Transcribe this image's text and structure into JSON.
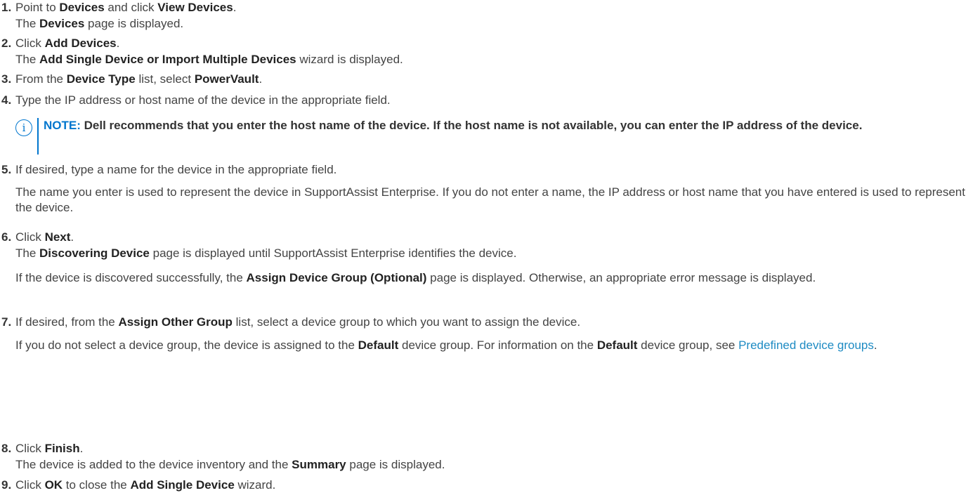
{
  "steps": [
    {
      "n": "1.",
      "a": "Point to ",
      "b1": "Devices",
      "c": " and click ",
      "b2": "View Devices",
      "d": ".",
      "sub_b": "Devices",
      "sub_rest": " page is displayed.",
      "sub_pre": "The "
    },
    {
      "n": "2.",
      "a": "Click ",
      "b1": "Add Devices",
      "d": ".",
      "sub_pre": "The ",
      "sub_b": "Add Single Device or Import Multiple Devices",
      "sub_rest": " wizard is displayed."
    },
    {
      "n": "3.",
      "a": "From the ",
      "b1": "Device Type",
      "c": " list, select ",
      "b2": "PowerVault",
      "d": "."
    },
    {
      "n": "4.",
      "a": "Type the IP address or host name of the device in the appropriate field."
    },
    {
      "n": "5.",
      "a": "If desired, type a name for the device in the appropriate field.",
      "para": "The name you enter is used to represent the device in SupportAssist Enterprise. If you do not enter a name, the IP address or host name that you have entered is used to represent the device."
    },
    {
      "n": "6.",
      "a": "Click ",
      "b1": "Next",
      "d": ".",
      "sub_pre": "The ",
      "sub_b": "Discovering Device",
      "sub_rest": " page is displayed until SupportAssist Enterprise identifies the device.",
      "para_pre": "If the device is discovered successfully, the ",
      "para_b": "Assign Device Group (Optional)",
      "para_rest": " page is displayed. Otherwise, an appropriate error message is displayed."
    },
    {
      "n": "7.",
      "a": "If desired, from the ",
      "b1": "Assign Other Group",
      "c": " list, select a device group to which you want to assign the device.",
      "para_pre": "If you do not select a device group, the device is assigned to the ",
      "para_b": "Default",
      "para_mid": " device group. For information on the ",
      "para_b2": "Default",
      "para_mid2": " device group, see ",
      "para_link": "Predefined device groups",
      "para_end": "."
    },
    {
      "n": "8.",
      "a": "Click ",
      "b1": "Finish",
      "d": ".",
      "sub_pre": "The device is added to the device inventory and the ",
      "sub_b": "Summary",
      "sub_rest": " page is displayed."
    },
    {
      "n": "9.",
      "a": "Click ",
      "b1": "OK",
      "c": " to close the ",
      "b2": "Add Single Device",
      "d": " wizard."
    }
  ],
  "note": {
    "icon": "info-icon",
    "label": "NOTE:",
    "text": " Dell recommends that you enter the host name of the device. If the host name is not available, you can enter the IP address of the device."
  },
  "colors": {
    "accent": "#0076ce",
    "link": "#1e8bc3"
  }
}
